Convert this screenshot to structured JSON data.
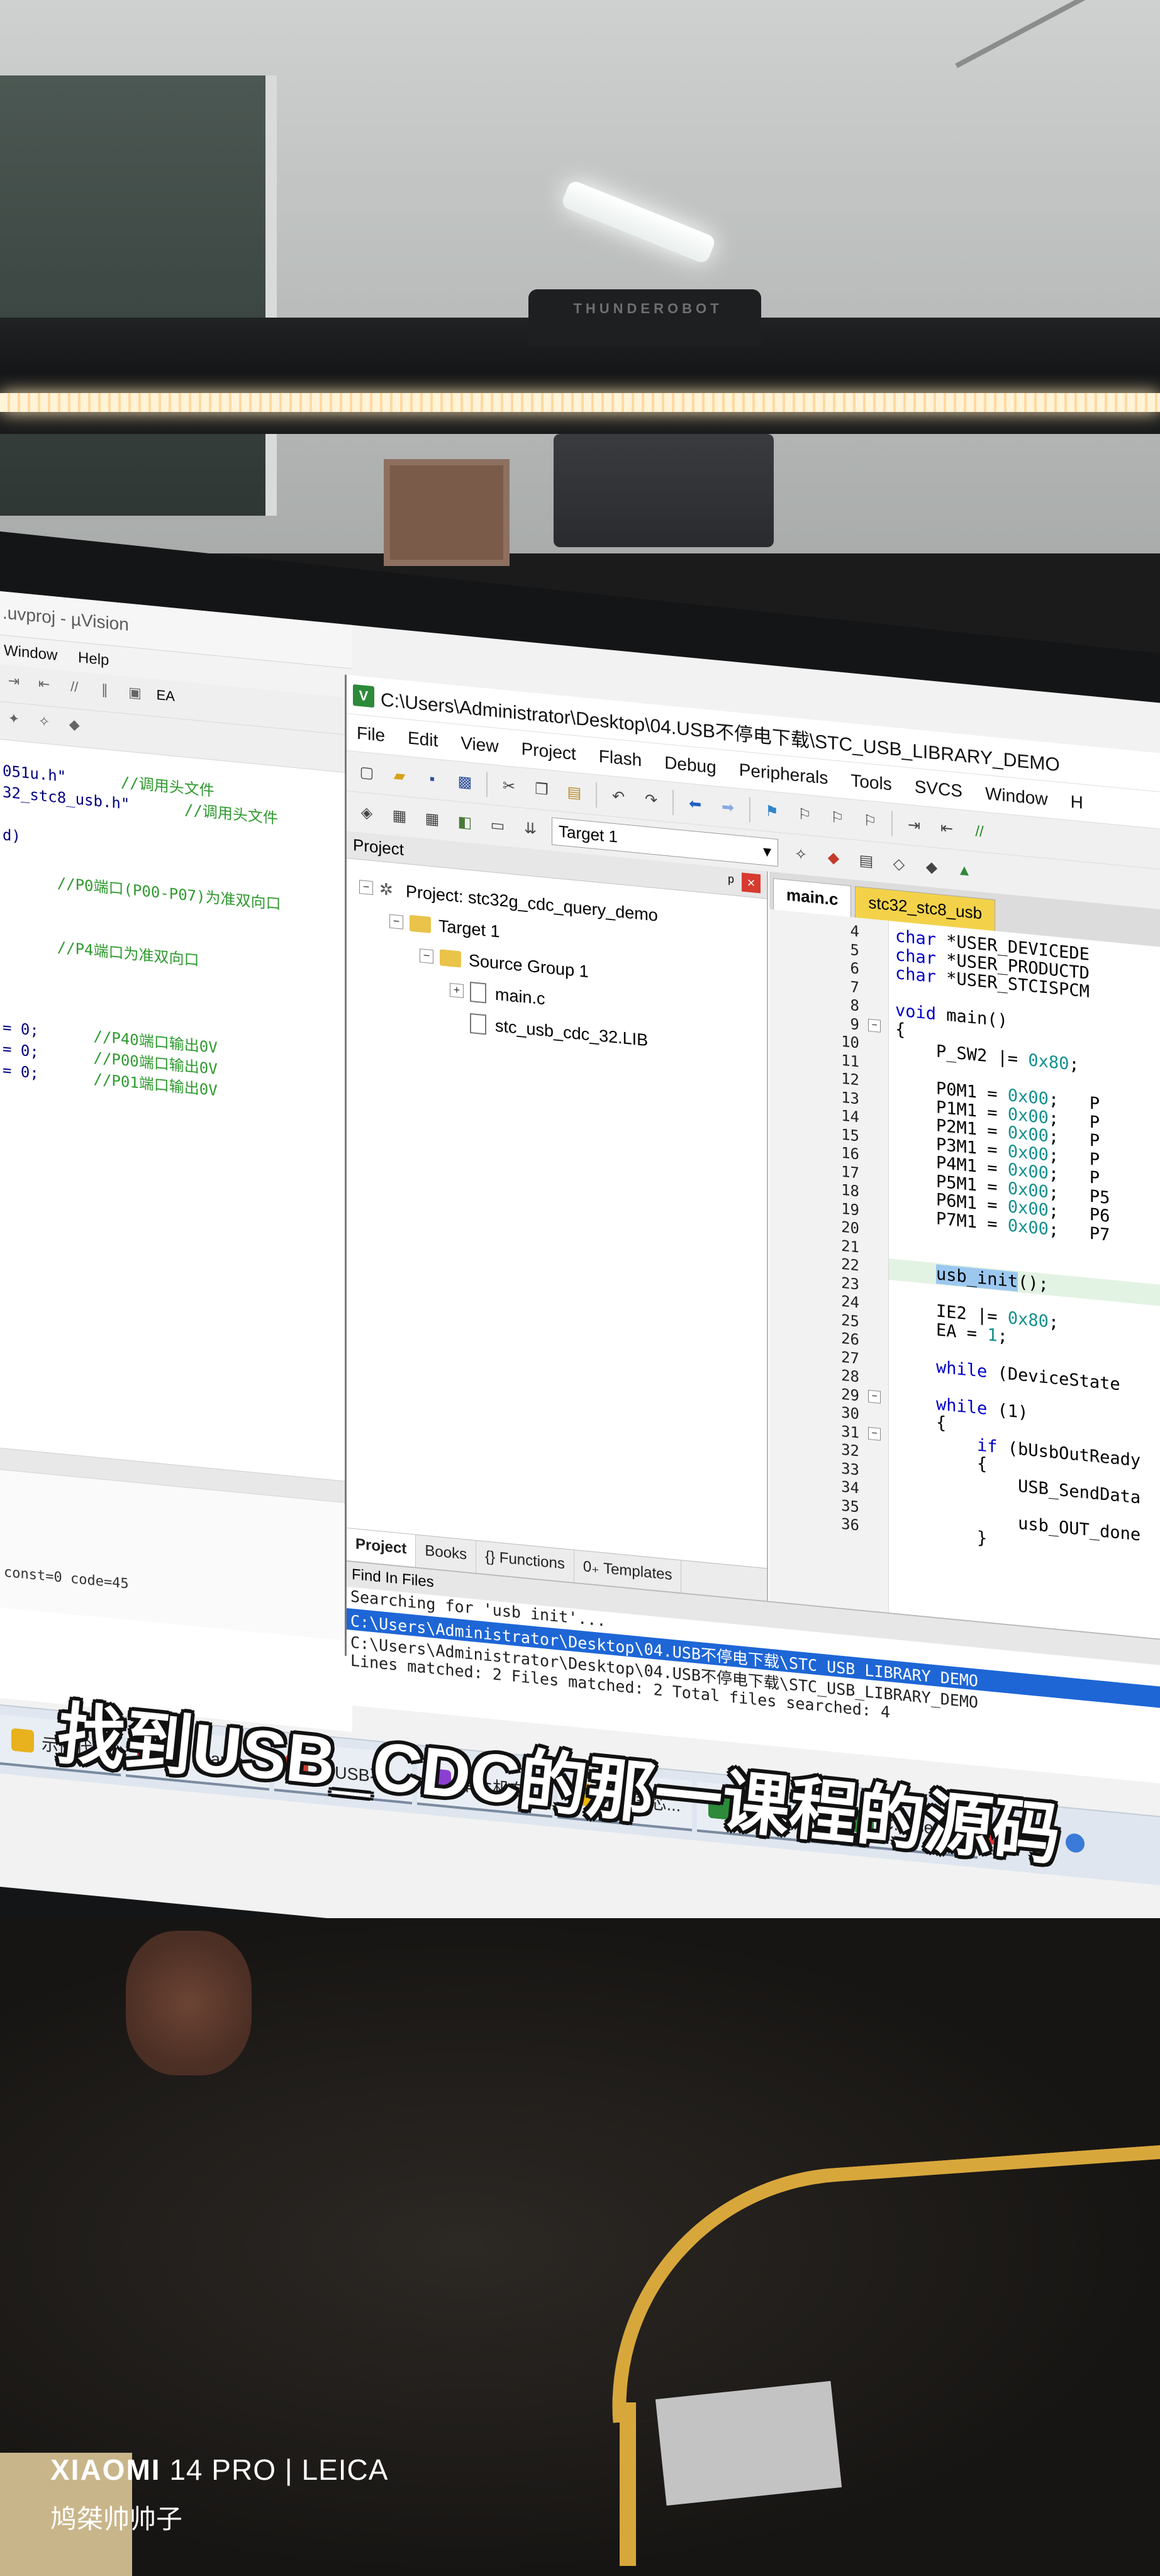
{
  "bg_window": {
    "title": ".uvproj - µVision",
    "menu": [
      "Window",
      "Help"
    ],
    "toolbar_label": "EA",
    "code_lines": [
      {
        "code": "051u.h\"",
        "comment": "//调用头文件"
      },
      {
        "code": "32_stc8_usb.h\"",
        "comment": "//调用头文件"
      },
      {
        "code": "",
        "comment": ""
      },
      {
        "code": "d)",
        "comment": ""
      },
      {
        "code": "",
        "comment": ""
      },
      {
        "code": "",
        "comment": "//P0端口(P00-P07)为准双向口"
      },
      {
        "code": "",
        "comment": ""
      },
      {
        "code": "",
        "comment": ""
      },
      {
        "code": "",
        "comment": "//P4端口为准双向口"
      },
      {
        "code": "",
        "comment": ""
      },
      {
        "code": "",
        "comment": ""
      },
      {
        "code": "",
        "comment": ""
      },
      {
        "code": "= 0;",
        "comment": "//P40端口输出0V"
      },
      {
        "code": "= 0;",
        "comment": "//P00端口输出0V"
      },
      {
        "code": "= 0;",
        "comment": "//P01端口输出0V"
      }
    ],
    "status": "const=0 code=45"
  },
  "window": {
    "title": "C:\\Users\\Administrator\\Desktop\\04.USB不停电下载\\STC_USB_LIBRARY_DEMO",
    "menu": [
      "File",
      "Edit",
      "View",
      "Project",
      "Flash",
      "Debug",
      "Peripherals",
      "Tools",
      "SVCS",
      "Window",
      "H"
    ],
    "target": "Target 1"
  },
  "project": {
    "header": "Project",
    "close_glyph": "×",
    "pin_glyph": "ᵖ",
    "tree": [
      {
        "label": "Project: stc32g_cdc_query_demo",
        "level": 0,
        "kind": "project",
        "exp": "−"
      },
      {
        "label": "Target 1",
        "level": 1,
        "kind": "folder",
        "exp": "−"
      },
      {
        "label": "Source Group 1",
        "level": 2,
        "kind": "folder",
        "exp": "−"
      },
      {
        "label": "main.c",
        "level": 3,
        "kind": "file",
        "exp": "+"
      },
      {
        "label": "stc_usb_cdc_32.LIB",
        "level": 3,
        "kind": "file",
        "exp": ""
      }
    ],
    "tabs": [
      "Project",
      "Books",
      "{} Functions",
      "0₊ Templates"
    ]
  },
  "editor": {
    "tabs": [
      "main.c",
      "stc32_stc8_usb"
    ],
    "lines": [
      {
        "n": "4",
        "html": "<span class='kw'>char</span> *USER_DEVICEDE"
      },
      {
        "n": "5",
        "html": "<span class='kw'>char</span> *USER_PRODUCTD"
      },
      {
        "n": "6",
        "html": "<span class='kw'>char</span> *USER_STCISPCM"
      },
      {
        "n": "7",
        "html": ""
      },
      {
        "n": "8",
        "html": "<span class='kw'>void</span> main()"
      },
      {
        "n": "9",
        "html": "{",
        "fold": "−"
      },
      {
        "n": "10",
        "html": "    P_SW2 |= <span class='hex'>0x80</span>;"
      },
      {
        "n": "11",
        "html": ""
      },
      {
        "n": "12",
        "html": "    P0M1 = <span class='hex'>0x00</span>;   P"
      },
      {
        "n": "13",
        "html": "    P1M1 = <span class='hex'>0x00</span>;   P"
      },
      {
        "n": "14",
        "html": "    P2M1 = <span class='hex'>0x00</span>;   P"
      },
      {
        "n": "15",
        "html": "    P3M1 = <span class='hex'>0x00</span>;   P"
      },
      {
        "n": "16",
        "html": "    P4M1 = <span class='hex'>0x00</span>;   P"
      },
      {
        "n": "17",
        "html": "    P5M1 = <span class='hex'>0x00</span>;   P5"
      },
      {
        "n": "18",
        "html": "    P6M1 = <span class='hex'>0x00</span>;   P6"
      },
      {
        "n": "19",
        "html": "    P7M1 = <span class='hex'>0x00</span>;   P7"
      },
      {
        "n": "20",
        "html": ""
      },
      {
        "n": "21",
        "html": ""
      },
      {
        "n": "22",
        "html": "    <span class='hl'>usb_init</span>();",
        "current": true
      },
      {
        "n": "23",
        "html": ""
      },
      {
        "n": "24",
        "html": "    IE2 |= <span class='hex'>0x80</span>;"
      },
      {
        "n": "25",
        "html": "    EA = <span class='hex'>1</span>;"
      },
      {
        "n": "26",
        "html": ""
      },
      {
        "n": "27",
        "html": "    <span class='kw'>while</span> (DeviceState"
      },
      {
        "n": "28",
        "html": ""
      },
      {
        "n": "29",
        "html": "    <span class='kw'>while</span> (1)",
        "fold": "−"
      },
      {
        "n": "30",
        "html": "    {"
      },
      {
        "n": "31",
        "html": "        <span class='kw'>if</span> (bUsbOutReady",
        "fold": "−"
      },
      {
        "n": "32",
        "html": "        {"
      },
      {
        "n": "33",
        "html": "            USB_SendData"
      },
      {
        "n": "34",
        "html": ""
      },
      {
        "n": "35",
        "html": "            usb_OUT_done"
      },
      {
        "n": "36",
        "html": "        }"
      }
    ]
  },
  "find_in_files": {
    "header": "Find In Files",
    "lines": [
      "Searching for 'usb init'...",
      "C:\\Users\\Administrator\\Desktop\\04.USB不停电下载\\STC USB LIBRARY DEMO",
      "C:\\Users\\Administrator\\Desktop\\04.USB不停电下载\\STC_USB_LIBRARY_DEMO",
      "Lines matched: 2          Files matched: 2          Total files searched: 4"
    ]
  },
  "taskbar": {
    "items": [
      {
        "label": "示例代码",
        "color": "#e7b21d"
      },
      {
        "label": "USBcame...",
        "color": "#e0393e"
      },
      {
        "label": "04USB不...",
        "color": "#d23c2f"
      },
      {
        "label": "单片机在...",
        "color": "#8a3fd1"
      },
      {
        "label": "深圳国芯...",
        "color": "#f0b400"
      },
      {
        "label": "C:\\Users\\...",
        "color": "#2d8a3a"
      },
      {
        "label": "C:\\Users\\...",
        "color": "#2d8a3a"
      }
    ]
  },
  "subtitle": "找到USB_CDC的那一课程的源码",
  "monitor_lamp_brand": "THUNDEROBOT",
  "watermark": {
    "brand": "XIAOMI",
    "model": "14 PRO",
    "separator": "|",
    "lens": "LEICA",
    "user": "鸠桀帅帅子"
  }
}
